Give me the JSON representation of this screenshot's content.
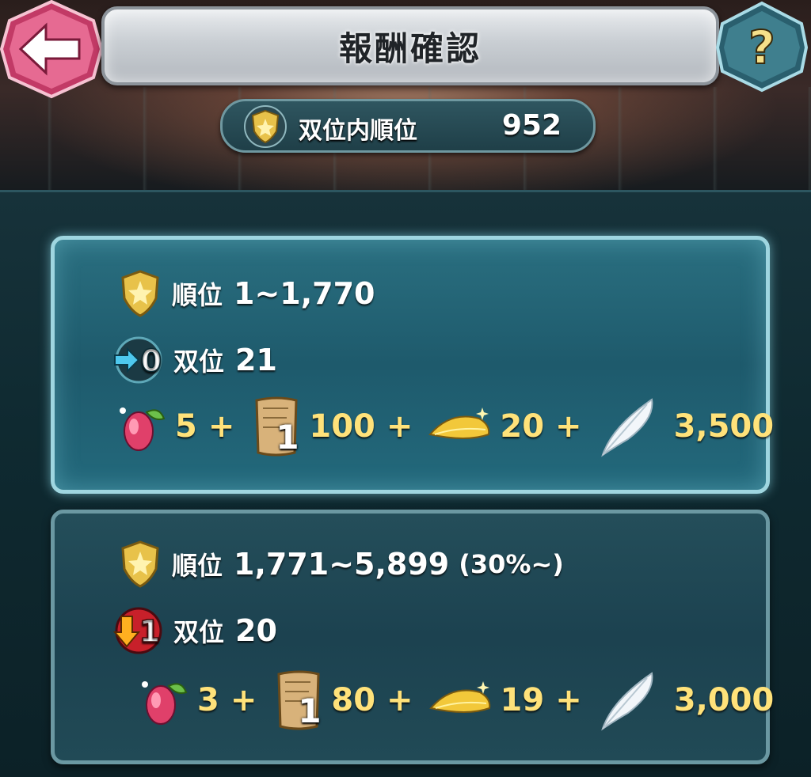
{
  "header": {
    "title": "報酬確認",
    "back_icon": "back-arrow-icon",
    "help_label": "?"
  },
  "rank_summary": {
    "label": "双位内順位",
    "value": "952"
  },
  "tiers": [
    {
      "rank_label": "順位",
      "rank_range": "1~1,770",
      "rank_extra": "",
      "tier_badge": "0",
      "tier_label": "双位",
      "tier_value": "21",
      "rewards": {
        "fruit": "5",
        "scroll_badge": "1",
        "scroll": "100",
        "leaf": "20",
        "feather": "3,500"
      }
    },
    {
      "rank_label": "順位",
      "rank_range": "1,771~5,899",
      "rank_extra": "(30%~)",
      "tier_badge": "1",
      "tier_label": "双位",
      "tier_value": "20",
      "rewards": {
        "fruit": "3",
        "scroll_badge": "1",
        "scroll": "80",
        "leaf": "19",
        "feather": "3,000"
      }
    }
  ],
  "symbols": {
    "plus": "+"
  },
  "colors": {
    "reward_text": "#ffe27a",
    "panel_active_border": "#9fd6e0",
    "panel_inactive_border": "#6b98a2",
    "back_button": "#e8628c",
    "help_button": "#3f7f8e"
  }
}
